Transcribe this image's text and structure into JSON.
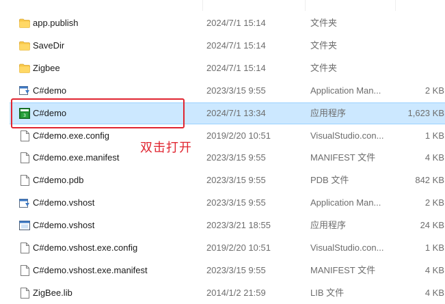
{
  "files": [
    {
      "icon": "folder-icon",
      "name": "app.publish",
      "date": "2024/7/1 15:14",
      "type": "文件夹",
      "size": ""
    },
    {
      "icon": "folder-icon",
      "name": "SaveDir",
      "date": "2024/7/1 15:14",
      "type": "文件夹",
      "size": ""
    },
    {
      "icon": "folder-icon",
      "name": "Zigbee",
      "date": "2024/7/1 15:14",
      "type": "文件夹",
      "size": ""
    },
    {
      "icon": "app-manifest-icon",
      "name": "C#demo",
      "date": "2023/3/15 9:55",
      "type": "Application Man...",
      "size": "2 KB"
    },
    {
      "icon": "csharp-app-icon",
      "name": "C#demo",
      "date": "2024/7/1 13:34",
      "type": "应用程序",
      "size": "1,623 KB"
    },
    {
      "icon": "document-icon",
      "name": "C#demo.exe.config",
      "date": "2019/2/20 10:51",
      "type": "VisualStudio.con...",
      "size": "1 KB"
    },
    {
      "icon": "document-icon",
      "name": "C#demo.exe.manifest",
      "date": "2023/3/15 9:55",
      "type": "MANIFEST 文件",
      "size": "4 KB"
    },
    {
      "icon": "document-icon",
      "name": "C#demo.pdb",
      "date": "2023/3/15 9:55",
      "type": "PDB 文件",
      "size": "842 KB"
    },
    {
      "icon": "app-manifest-icon",
      "name": "C#demo.vshost",
      "date": "2023/3/15 9:55",
      "type": "Application Man...",
      "size": "2 KB"
    },
    {
      "icon": "window-app-icon",
      "name": "C#demo.vshost",
      "date": "2023/3/21 18:55",
      "type": "应用程序",
      "size": "24 KB"
    },
    {
      "icon": "document-icon",
      "name": "C#demo.vshost.exe.config",
      "date": "2019/2/20 10:51",
      "type": "VisualStudio.con...",
      "size": "1 KB"
    },
    {
      "icon": "document-icon",
      "name": "C#demo.vshost.exe.manifest",
      "date": "2023/3/15 9:55",
      "type": "MANIFEST 文件",
      "size": "4 KB"
    },
    {
      "icon": "document-icon",
      "name": "ZigBee.lib",
      "date": "2014/1/2 21:59",
      "type": "LIB 文件",
      "size": "4 KB"
    }
  ],
  "annotation": {
    "text": "双击打开",
    "color": "#e0242f"
  },
  "colors": {
    "selection": "#cce8ff",
    "folder": "#f8c84a"
  }
}
